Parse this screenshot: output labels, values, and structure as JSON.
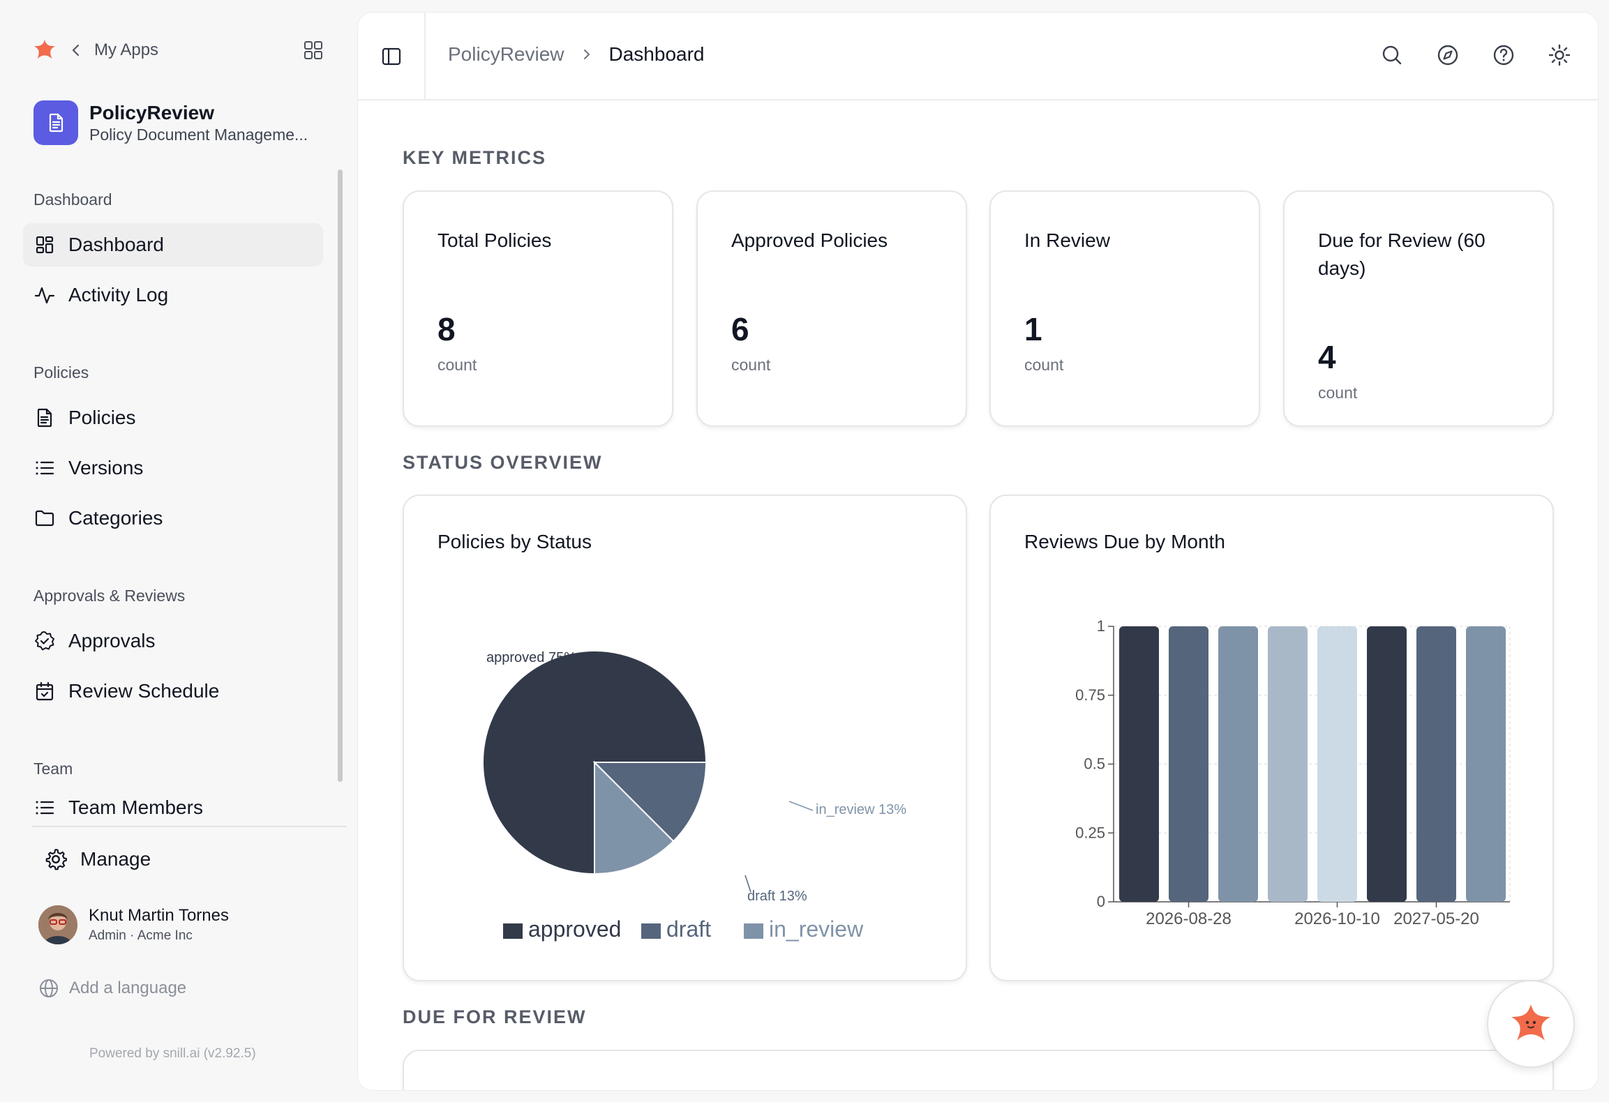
{
  "sidebar": {
    "my_apps_label": "My Apps",
    "app": {
      "name": "PolicyReview",
      "subtitle": "Policy Document Manageme..."
    },
    "sections": {
      "dashboard": "Dashboard",
      "policies": "Policies",
      "approvals": "Approvals & Reviews",
      "team": "Team"
    },
    "items": {
      "dashboard": "Dashboard",
      "activity_log": "Activity Log",
      "policies": "Policies",
      "versions": "Versions",
      "categories": "Categories",
      "approvals": "Approvals",
      "review_schedule": "Review Schedule",
      "team_members": "Team Members"
    },
    "manage_label": "Manage",
    "user": {
      "name": "Knut Martin Tornes",
      "role": "Admin · Acme Inc"
    },
    "add_language": "Add a language",
    "powered_by": "Powered by snill.ai (v2.92.5)"
  },
  "header": {
    "breadcrumb_parent": "PolicyReview",
    "breadcrumb_current": "Dashboard"
  },
  "sections": {
    "key_metrics": "KEY METRICS",
    "status_overview": "STATUS OVERVIEW",
    "due_for_review": "DUE FOR REVIEW"
  },
  "metrics": [
    {
      "title": "Total Policies",
      "value": "8",
      "unit": "count"
    },
    {
      "title": "Approved Policies",
      "value": "6",
      "unit": "count"
    },
    {
      "title": "In Review",
      "value": "1",
      "unit": "count"
    },
    {
      "title": "Due for Review (60 days)",
      "value": "4",
      "unit": "count"
    }
  ],
  "charts": {
    "status_title": "Policies by Status",
    "reviews_title": "Reviews Due by Month"
  },
  "colors": {
    "approved": "#323a4a",
    "draft": "#55657c",
    "in_review": "#7f93a8",
    "light1": "#a9b8c7",
    "light2": "#cbdae4",
    "accent": "#5b5ce2",
    "brand": "#f26b4b"
  },
  "chart_data": [
    {
      "type": "pie",
      "title": "Policies by Status",
      "labels": [
        "approved",
        "draft",
        "in_review"
      ],
      "values": [
        6,
        1,
        1
      ],
      "slice_labels": [
        "approved 75%",
        "draft 13%",
        "in_review 13%"
      ],
      "legend": "bottom"
    },
    {
      "type": "bar",
      "title": "Reviews Due by Month",
      "categories": [
        "",
        "2026-08-28",
        "",
        "",
        "2026-10-10",
        "",
        "2027-05-20",
        ""
      ],
      "tick_labels": [
        "2026-08-28",
        "2026-10-10",
        "2027-05-20"
      ],
      "values": [
        1,
        1,
        1,
        1,
        1,
        1,
        1,
        1
      ],
      "bar_colors": [
        "#323a4a",
        "#55657c",
        "#7f93a8",
        "#a9b8c7",
        "#cbdae4",
        "#323a4a",
        "#55657c",
        "#7f93a8"
      ],
      "ylim": [
        0,
        1
      ],
      "yticks": [
        "0",
        "0.25",
        "0.5",
        "0.75",
        "1"
      ],
      "grid": true
    }
  ]
}
